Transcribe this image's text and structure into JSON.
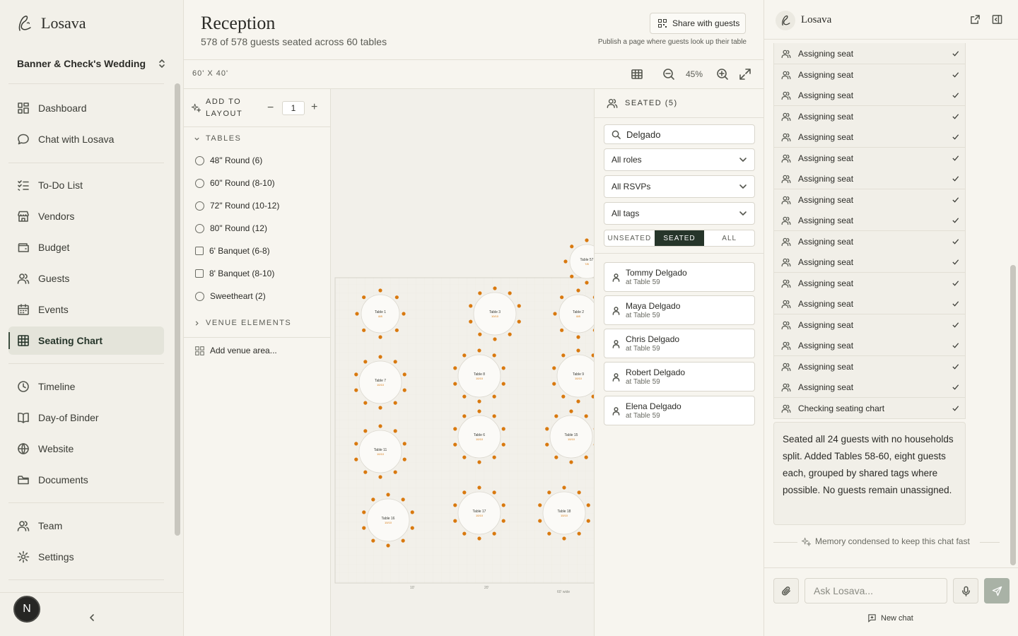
{
  "sidebar": {
    "brand": "Losava",
    "wedding": "Banner & Check's Wedding",
    "nav": [
      {
        "label": "Dashboard",
        "icon": "dashboard-icon"
      },
      {
        "label": "Chat with Losava",
        "icon": "chat-icon"
      },
      {
        "label": "To-Do List",
        "icon": "checklist-icon"
      },
      {
        "label": "Vendors",
        "icon": "store-icon"
      },
      {
        "label": "Budget",
        "icon": "wallet-icon"
      },
      {
        "label": "Guests",
        "icon": "users-icon"
      },
      {
        "label": "Events",
        "icon": "calendar-icon"
      },
      {
        "label": "Seating Chart",
        "icon": "grid-icon",
        "active": true
      },
      {
        "label": "Timeline",
        "icon": "clock-icon"
      },
      {
        "label": "Day-of Binder",
        "icon": "book-icon"
      },
      {
        "label": "Website",
        "icon": "globe-icon"
      },
      {
        "label": "Documents",
        "icon": "folder-icon"
      },
      {
        "label": "Team",
        "icon": "team-icon"
      },
      {
        "label": "Settings",
        "icon": "gear-icon"
      }
    ],
    "avatar": "N"
  },
  "header": {
    "title": "Reception",
    "subtitle": "578 of 578 guests seated across 60 tables",
    "share_label": "Share with guests",
    "share_hint": "Publish a page where guests look up their table"
  },
  "toolbar": {
    "dimensions": "60' X 40'",
    "zoom": "45%"
  },
  "palette": {
    "add_label": "ADD TO LAYOUT",
    "quantity": "1",
    "tables_header": "TABLES",
    "tables": [
      {
        "label": "48\" Round (6)",
        "shape": "round"
      },
      {
        "label": "60\" Round (8-10)",
        "shape": "round"
      },
      {
        "label": "72\" Round (10-12)",
        "shape": "round"
      },
      {
        "label": "80\" Round (12)",
        "shape": "round"
      },
      {
        "label": "6' Banquet (6-8)",
        "shape": "banquet"
      },
      {
        "label": "8' Banquet (8-10)",
        "shape": "banquet"
      },
      {
        "label": "Sweetheart (2)",
        "shape": "round"
      }
    ],
    "venue_header": "VENUE ELEMENTS",
    "add_venue": "Add venue area..."
  },
  "canvas": {
    "tables": [
      {
        "name": "Table 1",
        "count": "8/8"
      },
      {
        "name": "Table 3",
        "count": "10/10"
      },
      {
        "name": "Table 2",
        "count": "8/8"
      },
      {
        "name": "Table 7",
        "count": "10/10"
      },
      {
        "name": "Table 8",
        "count": "10/10"
      },
      {
        "name": "Table 9",
        "count": "10/10"
      },
      {
        "name": "Table 11",
        "count": "10/10"
      },
      {
        "name": "Table 6",
        "count": "10/10"
      },
      {
        "name": "Table 15",
        "count": "10/10"
      },
      {
        "name": "Table 16",
        "count": "10/10"
      },
      {
        "name": "Table 17",
        "count": "10/10"
      },
      {
        "name": "Table 18",
        "count": "10/10"
      },
      {
        "name": "Table 57",
        "count": "7/8"
      }
    ],
    "ruler": [
      "10'",
      "20'",
      "60' wide"
    ]
  },
  "filters": {
    "seated_header": "SEATED (5)",
    "search_value": "Delgado",
    "roles": "All roles",
    "rsvps": "All RSVPs",
    "tags": "All tags",
    "segments": [
      "UNSEATED",
      "SEATED",
      "ALL"
    ],
    "active_segment": "SEATED",
    "guests": [
      {
        "name": "Tommy Delgado",
        "table": "at Table 59"
      },
      {
        "name": "Maya Delgado",
        "table": "at Table 59"
      },
      {
        "name": "Chris Delgado",
        "table": "at Table 59"
      },
      {
        "name": "Robert Delgado",
        "table": "at Table 59"
      },
      {
        "name": "Elena Delgado",
        "table": "at Table 59"
      }
    ]
  },
  "chat": {
    "title": "Losava",
    "steps": [
      "Assigning seat",
      "Assigning seat",
      "Assigning seat",
      "Assigning seat",
      "Assigning seat",
      "Assigning seat",
      "Assigning seat",
      "Assigning seat",
      "Assigning seat",
      "Assigning seat",
      "Assigning seat",
      "Assigning seat",
      "Assigning seat",
      "Assigning seat",
      "Assigning seat",
      "Assigning seat",
      "Assigning seat",
      "Checking seating chart"
    ],
    "summary": "Seated all 24 guests with no households split. Added Tables 58-60, eight guests each, grouped by shared tags where possible. No guests remain unassigned.",
    "memory_note": "Memory condensed to keep this chat fast",
    "input_placeholder": "Ask Losava...",
    "new_chat": "New chat"
  },
  "colors": {
    "accent": "#26352a",
    "seat": "#d9790f",
    "background": "#f7f5ef"
  }
}
